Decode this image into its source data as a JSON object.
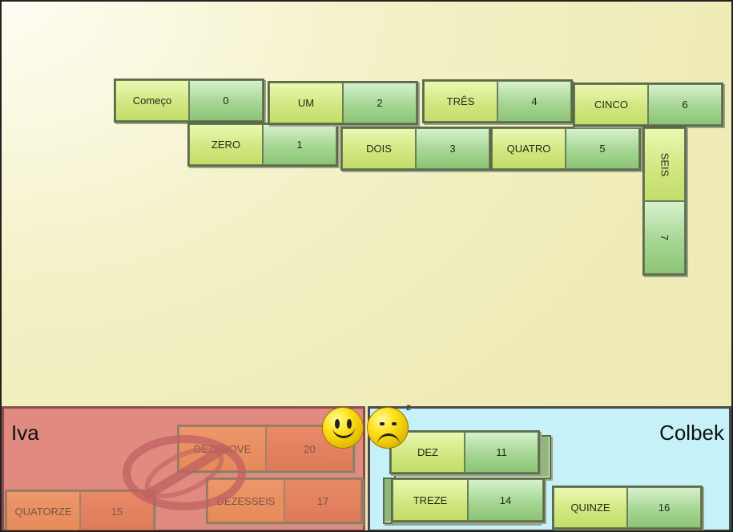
{
  "board": {
    "tiles": [
      {
        "word": "Começo",
        "num": "0"
      },
      {
        "word": "ZERO",
        "num": "1"
      },
      {
        "word": "UM",
        "num": "2"
      },
      {
        "word": "DOIS",
        "num": "3"
      },
      {
        "word": "TRÊS",
        "num": "4"
      },
      {
        "word": "QUATRO",
        "num": "5"
      },
      {
        "word": "CINCO",
        "num": "6"
      },
      {
        "word": "SEIS",
        "num": "7"
      }
    ]
  },
  "players": {
    "iva": {
      "name": "Iva",
      "tiles": [
        {
          "word": "DEZENOVE",
          "num": "20"
        },
        {
          "word": "DEZESSEIS",
          "num": "17"
        },
        {
          "word": "QUATORZE",
          "num": "15"
        }
      ]
    },
    "colbek": {
      "name": "Colbek",
      "tiles": [
        {
          "word": "DEZ",
          "num": "11"
        },
        {
          "word": "TREZE",
          "num": "14"
        },
        {
          "word": "QUINZE",
          "num": "16"
        }
      ]
    }
  },
  "status": {
    "iva_icon": "happy-face-icon",
    "colbek_icon": "sad-sleepy-face-icon",
    "block_icon": "no-sign-icon"
  }
}
